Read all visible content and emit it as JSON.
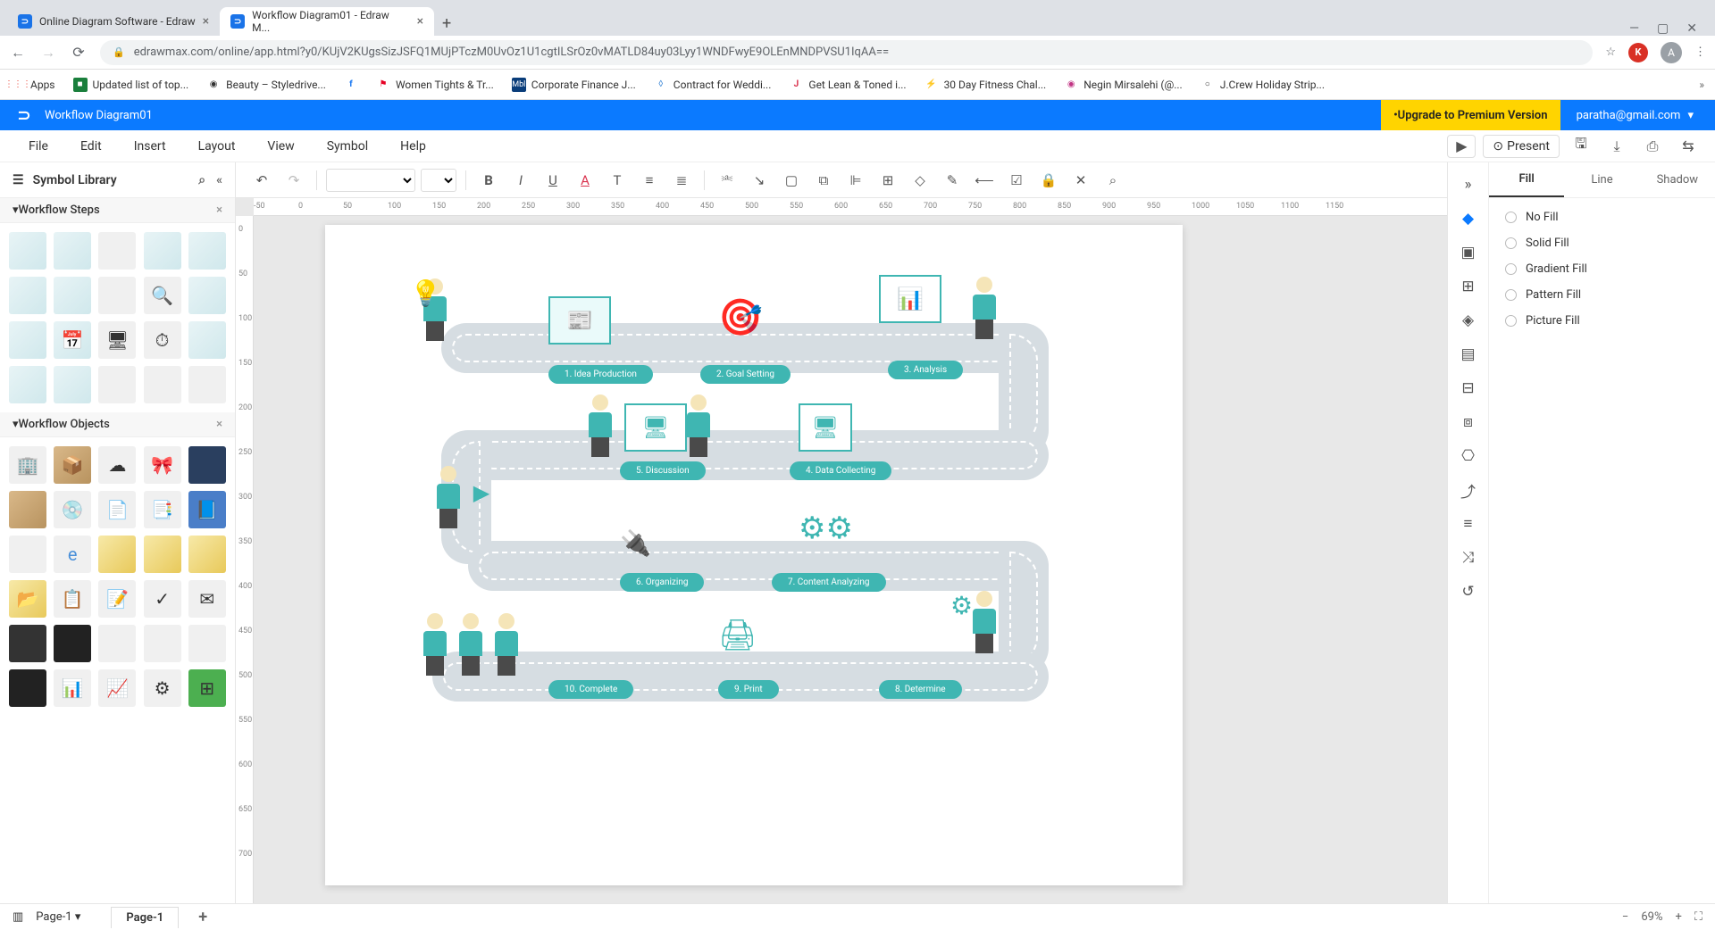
{
  "browser": {
    "tabs": [
      {
        "title": "Online Diagram Software - Edraw",
        "active": false
      },
      {
        "title": "Workflow Diagram01 - Edraw M...",
        "active": true
      }
    ],
    "url": "edrawmax.com/online/app.html?y0/KUjV2KUgsSizJSFQ1MUjPTczM0UvOz1U1cgtILSrOz0vMATLD84uy03Lyy1WNDFwyE9OLEnMNDPVSU1IqAA==",
    "bookmarks": [
      {
        "icon": "⋮⋮⋮",
        "label": "Apps",
        "color": "#5f6368"
      },
      {
        "icon": "■",
        "label": "Updated list of top...",
        "color": "#1a7f3c"
      },
      {
        "icon": "◉",
        "label": "Beauty – Styledrive...",
        "color": "#666"
      },
      {
        "icon": "f",
        "label": "",
        "color": "#1877f2"
      },
      {
        "icon": "⚑",
        "label": "Women Tights & Tr...",
        "color": "#e60023"
      },
      {
        "icon": "M",
        "label": "Corporate Finance J...",
        "color": "#0a3d7a"
      },
      {
        "icon": "◊",
        "label": "Contract for Weddi...",
        "color": "#4a90d9"
      },
      {
        "icon": "J",
        "label": "Get Lean & Toned i...",
        "color": "#d9304c"
      },
      {
        "icon": "⚡",
        "label": "30 Day Fitness Chal...",
        "color": "#222"
      },
      {
        "icon": "◉",
        "label": "Negin Mirsalehi (@...",
        "color": "#c13584"
      },
      {
        "icon": "○",
        "label": "J.Crew Holiday Strip...",
        "color": "#666"
      }
    ]
  },
  "app": {
    "title": "Workflow Diagram01",
    "upgrade": "Upgrade to Premium Version",
    "user": "paratha@gmail.com"
  },
  "menu": {
    "items": [
      "File",
      "Edit",
      "Insert",
      "Layout",
      "View",
      "Symbol",
      "Help"
    ],
    "present": "Present"
  },
  "sidebar": {
    "title": "Symbol Library",
    "sections": [
      {
        "title": "Workflow Steps"
      },
      {
        "title": "Workflow Objects"
      }
    ]
  },
  "workflow": {
    "steps": [
      {
        "label": "1. Idea Production"
      },
      {
        "label": "2. Goal Setting"
      },
      {
        "label": "3. Analysis"
      },
      {
        "label": "4. Data Collecting"
      },
      {
        "label": "5. Discussion"
      },
      {
        "label": "6. Organizing"
      },
      {
        "label": "7. Content Analyzing"
      },
      {
        "label": "8. Determine"
      },
      {
        "label": "9. Print"
      },
      {
        "label": "10. Complete"
      }
    ]
  },
  "rightPanel": {
    "tabs": [
      "Fill",
      "Line",
      "Shadow"
    ],
    "fillOptions": [
      "No Fill",
      "Solid Fill",
      "Gradient Fill",
      "Pattern Fill",
      "Picture Fill"
    ]
  },
  "status": {
    "pageSelect": "Page-1",
    "pageTabs": [
      "Page-1"
    ],
    "zoom": "69%"
  },
  "ruler_h": [
    "-50",
    "0",
    "50",
    "100",
    "150",
    "200",
    "250",
    "300",
    "350",
    "400",
    "450",
    "500",
    "550",
    "600",
    "650",
    "700",
    "750",
    "800",
    "850",
    "900",
    "950",
    "1000",
    "1050",
    "1100",
    "1150"
  ],
  "ruler_v": [
    "0",
    "50",
    "100",
    "150",
    "200",
    "250",
    "300",
    "350",
    "400",
    "450",
    "500",
    "550",
    "600",
    "650",
    "700"
  ]
}
